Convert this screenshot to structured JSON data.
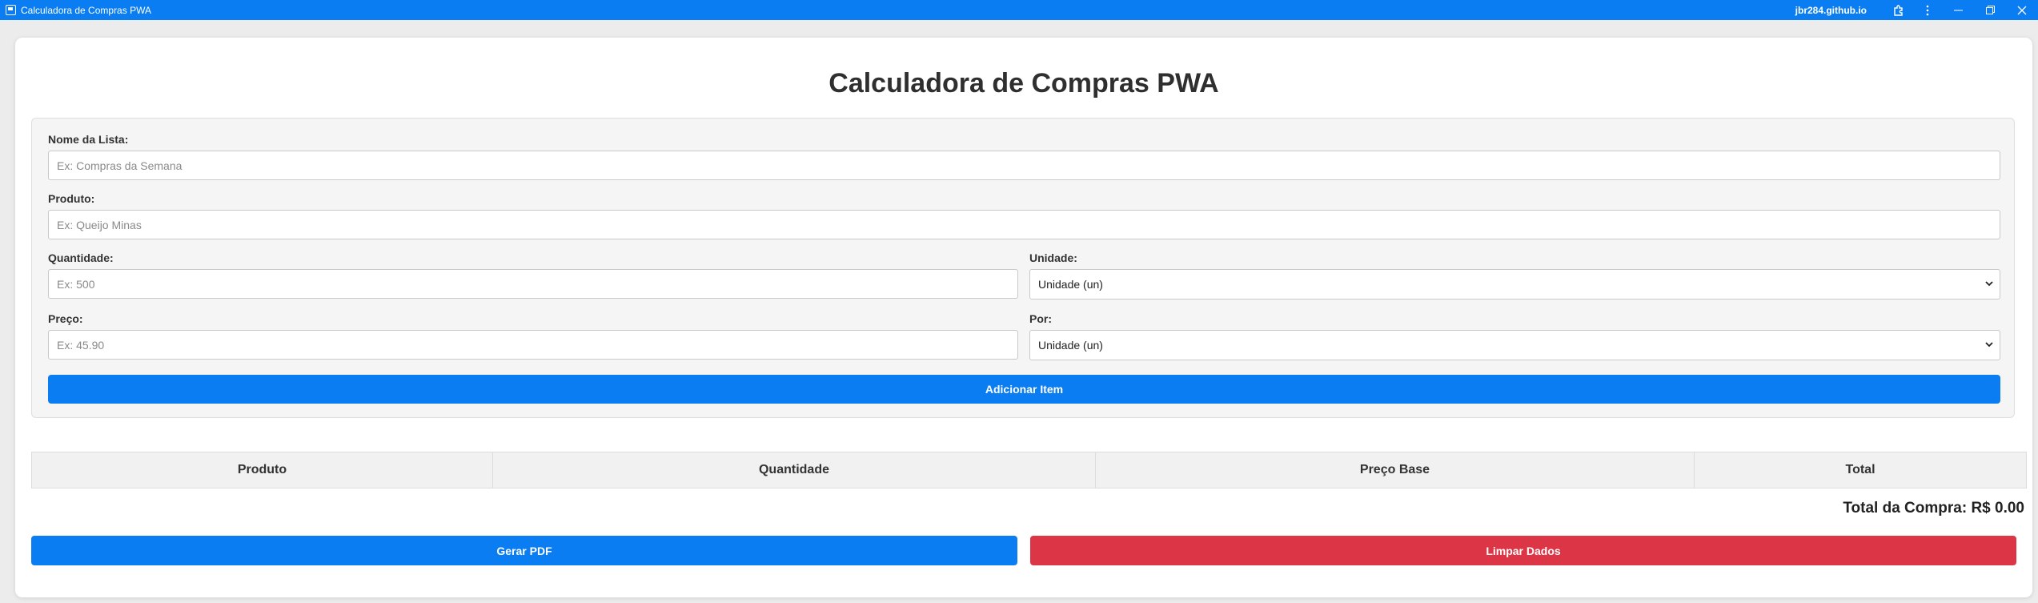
{
  "window": {
    "title": "Calculadora de Compras PWA",
    "domain": "jbr284.github.io",
    "controls": {
      "extensions_icon": "puzzle-icon",
      "menu_icon": "kebab-icon",
      "minimize": "─",
      "restore": "❐",
      "close": "✕"
    }
  },
  "page": {
    "title": "Calculadora de Compras PWA"
  },
  "form": {
    "list_name": {
      "label": "Nome da Lista:",
      "placeholder": "Ex: Compras da Semana",
      "value": ""
    },
    "product": {
      "label": "Produto:",
      "placeholder": "Ex: Queijo Minas",
      "value": ""
    },
    "quantity": {
      "label": "Quantidade:",
      "placeholder": "Ex: 500",
      "value": ""
    },
    "unit": {
      "label": "Unidade:",
      "selected": "Unidade (un)"
    },
    "price": {
      "label": "Preço:",
      "placeholder": "Ex: 45.90",
      "value": ""
    },
    "per": {
      "label": "Por:",
      "selected": "Unidade (un)"
    },
    "add_button": "Adicionar Item"
  },
  "table": {
    "columns": [
      "Produto",
      "Quantidade",
      "Preço Base",
      "Total"
    ],
    "rows": []
  },
  "summary": {
    "total_text": "Total da Compra: R$ 0.00"
  },
  "actions": {
    "pdf_button": "Gerar PDF",
    "clear_button": "Limpar Dados"
  },
  "colors": {
    "accent": "#0a7df2",
    "danger": "#dc3545",
    "titlebar": "#0a7df2"
  }
}
